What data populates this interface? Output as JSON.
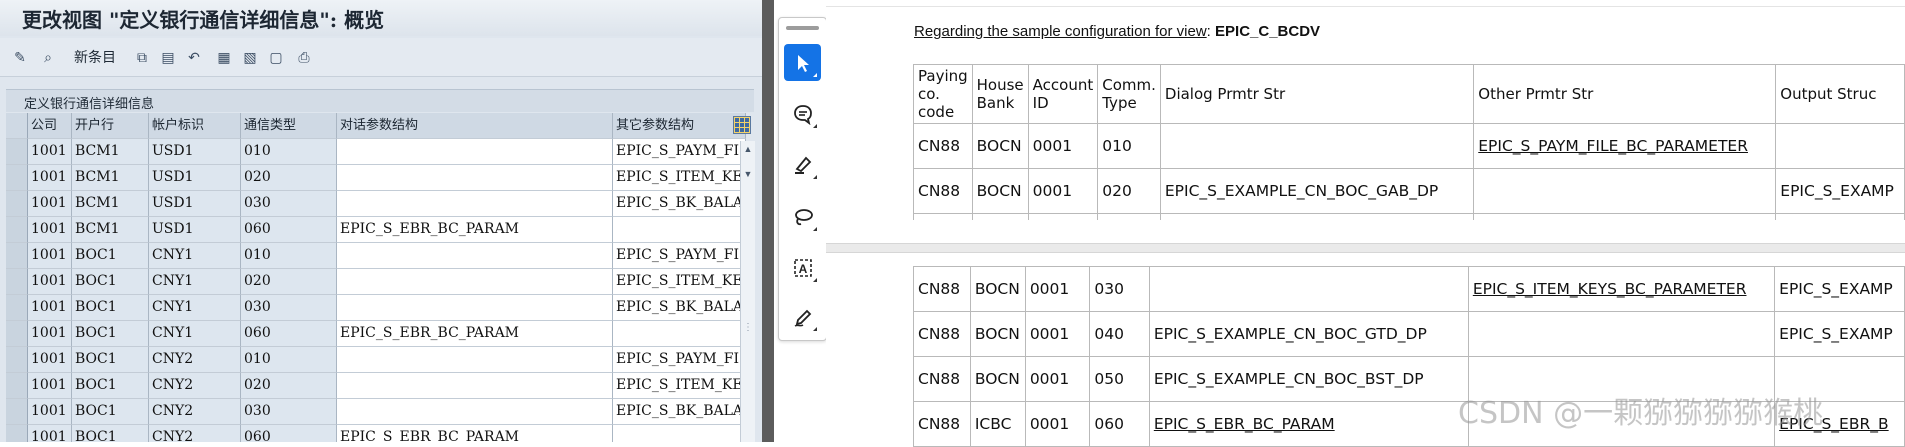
{
  "sap": {
    "title": "更改视图 \"定义银行通信详细信息\": 概览",
    "toolbar": {
      "new_entries": "新条目"
    },
    "panel_title": "定义银行通信详细信息",
    "columns": [
      "公司",
      "开户行",
      "帐户标识",
      "通信类型",
      "对话参数结构",
      "其它参数结构"
    ],
    "rows": [
      [
        "1001",
        "BCM1",
        "USD1",
        "010",
        "",
        "EPIC_S_PAYM_FI"
      ],
      [
        "1001",
        "BCM1",
        "USD1",
        "020",
        "",
        "EPIC_S_ITEM_KEY"
      ],
      [
        "1001",
        "BCM1",
        "USD1",
        "030",
        "",
        "EPIC_S_BK_BALA"
      ],
      [
        "1001",
        "BCM1",
        "USD1",
        "060",
        "EPIC_S_EBR_BC_PARAM",
        ""
      ],
      [
        "1001",
        "BOC1",
        "CNY1",
        "010",
        "",
        "EPIC_S_PAYM_FI"
      ],
      [
        "1001",
        "BOC1",
        "CNY1",
        "020",
        "",
        "EPIC_S_ITEM_KEY"
      ],
      [
        "1001",
        "BOC1",
        "CNY1",
        "030",
        "",
        "EPIC_S_BK_BALA"
      ],
      [
        "1001",
        "BOC1",
        "CNY1",
        "060",
        "EPIC_S_EBR_BC_PARAM",
        ""
      ],
      [
        "1001",
        "BOC1",
        "CNY2",
        "010",
        "",
        "EPIC_S_PAYM_FI"
      ],
      [
        "1001",
        "BOC1",
        "CNY2",
        "020",
        "",
        "EPIC_S_ITEM_KEY"
      ],
      [
        "1001",
        "BOC1",
        "CNY2",
        "030",
        "",
        "EPIC_S_BK_BALA"
      ],
      [
        "1001",
        "BOC1",
        "CNY2",
        "060",
        "EPIC_S_EBR_BC_PARAM",
        ""
      ]
    ]
  },
  "annotation_tools": [
    "select-arrow-icon",
    "comment-icon",
    "highlighter-icon",
    "lasso-icon",
    "text-box-icon",
    "sign-pen-icon"
  ],
  "doc": {
    "intro_prefix": "Regarding the sample configuration for view",
    "intro_colon": ": ",
    "intro_view": "EPIC_C_BCDV",
    "headers": [
      "Paying co. code",
      "House Bank",
      "Account ID",
      "Comm. Type",
      "Dialog Prmtr Str",
      "Other Prmtr Str",
      "Output Struc"
    ],
    "rows_page1": [
      [
        "CN88",
        "BOCN",
        "0001",
        "010",
        "",
        "EPIC_S_PAYM_FILE_BC_PARAMETER",
        ""
      ],
      [
        "CN88",
        "BOCN",
        "0001",
        "020",
        "EPIC_S_EXAMPLE_CN_BOC_GAB_DP",
        "",
        "EPIC_S_EXAMP"
      ]
    ],
    "rows_page2": [
      [
        "CN88",
        "BOCN",
        "0001",
        "030",
        "",
        "EPIC_S_ITEM_KEYS_BC_PARAMETER",
        "EPIC_S_EXAMP"
      ],
      [
        "CN88",
        "BOCN",
        "0001",
        "040",
        "EPIC_S_EXAMPLE_CN_BOC_GTD_DP",
        "",
        "EPIC_S_EXAMP"
      ],
      [
        "CN88",
        "BOCN",
        "0001",
        "050",
        "EPIC_S_EXAMPLE_CN_BOC_BST_DP",
        "",
        ""
      ],
      [
        "CN88",
        "ICBC",
        "0001",
        "060",
        "EPIC_S_EBR_BC_PARAM",
        "",
        "EPIC_S_EBR_B"
      ]
    ]
  },
  "watermark": "CSDN @一颗猕猕猕猕猴桃"
}
